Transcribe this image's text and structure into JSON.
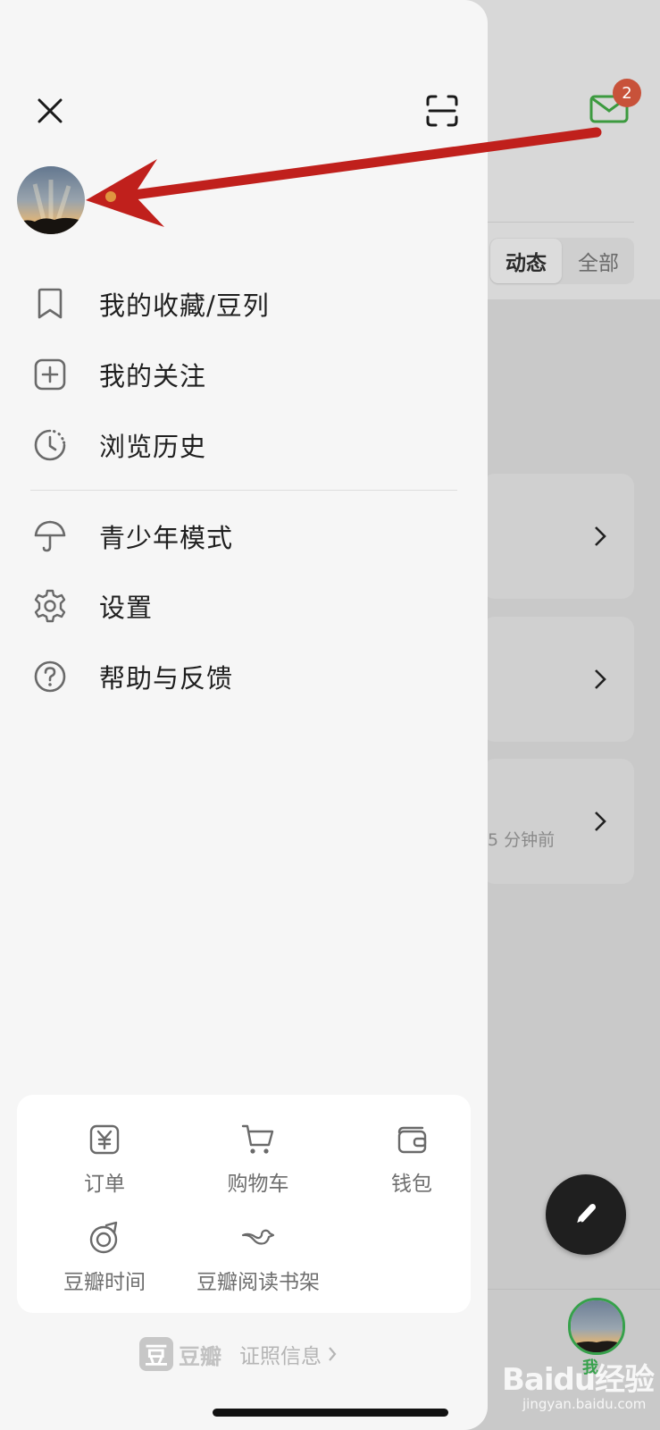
{
  "background": {
    "segment_tabs": [
      "动态",
      "全部"
    ],
    "mail_badge": "2",
    "card_time": "5 分钟前",
    "tab_me_label": "我",
    "watermark": "Baidu经验",
    "watermark_sub": "jingyan.baidu.com"
  },
  "drawer": {
    "menu_group_1": [
      {
        "label": "我的收藏/豆列",
        "icon": "bookmark-icon"
      },
      {
        "label": "我的关注",
        "icon": "plus-square-icon"
      },
      {
        "label": "浏览历史",
        "icon": "history-clock-icon"
      }
    ],
    "menu_group_2": [
      {
        "label": "青少年模式",
        "icon": "umbrella-icon"
      },
      {
        "label": "设置",
        "icon": "gear-icon"
      },
      {
        "label": "帮助与反馈",
        "icon": "help-circle-icon"
      }
    ],
    "tools": [
      {
        "label": "订单",
        "icon": "yen-order-icon"
      },
      {
        "label": "购物车",
        "icon": "cart-icon"
      },
      {
        "label": "钱包",
        "icon": "wallet-icon"
      },
      {
        "label": "豆瓣时间",
        "icon": "douban-time-icon"
      },
      {
        "label": "豆瓣阅读书架",
        "icon": "bird-bookshelf-icon"
      }
    ],
    "footer": {
      "logo_char": "豆",
      "logo_text": "豆瓣",
      "license_text": "证照信息"
    }
  },
  "colors": {
    "accent_green": "#36a14b",
    "badge_red": "#c8523a",
    "annotation_arrow": "#c0201c",
    "drawer_bg": "#f6f6f6"
  }
}
